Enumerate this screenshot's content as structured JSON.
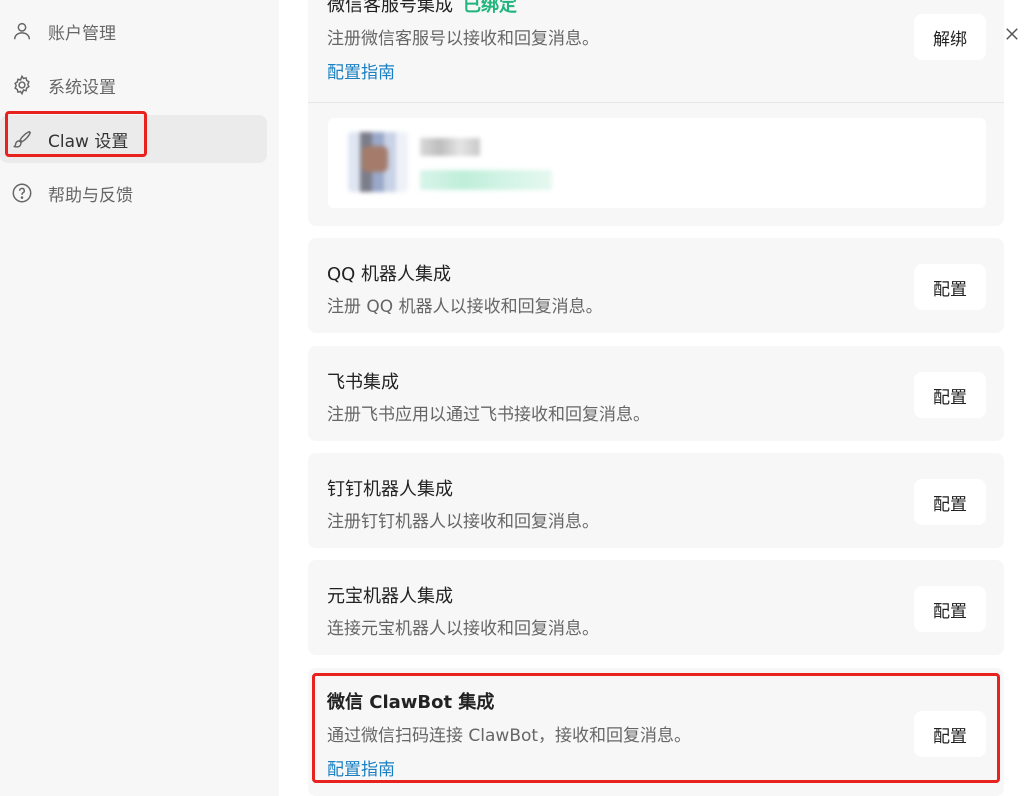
{
  "sidebar": {
    "items": [
      {
        "label": "账户管理",
        "icon": "user-icon"
      },
      {
        "label": "系统设置",
        "icon": "gear-icon"
      },
      {
        "label": "Claw 设置",
        "icon": "brush-icon",
        "active": true
      },
      {
        "label": "帮助与反馈",
        "icon": "help-icon"
      }
    ]
  },
  "integrations": {
    "wechat_service": {
      "title": "微信客服号集成",
      "status": "已绑定",
      "description": "注册微信客服号以接收和回复消息。",
      "guide_link": "配置指南",
      "button": "解绑"
    },
    "qq": {
      "title": "QQ 机器人集成",
      "description": "注册 QQ 机器人以接收和回复消息。",
      "button": "配置"
    },
    "feishu": {
      "title": "飞书集成",
      "description": "注册飞书应用以通过飞书接收和回复消息。",
      "button": "配置"
    },
    "dingtalk": {
      "title": "钉钉机器人集成",
      "description": "注册钉钉机器人以接收和回复消息。",
      "button": "配置"
    },
    "yuanbao": {
      "title": "元宝机器人集成",
      "description": "连接元宝机器人以接收和回复消息。",
      "button": "配置"
    },
    "wechat_clawbot": {
      "title": "微信 ClawBot 集成",
      "description": "通过微信扫码连接 ClawBot，接收和回复消息。",
      "guide_link": "配置指南",
      "button": "配置"
    }
  },
  "colors": {
    "accent_link": "#1a7fc1",
    "status_green": "#1fb57c",
    "highlight_red": "#e8231f"
  }
}
